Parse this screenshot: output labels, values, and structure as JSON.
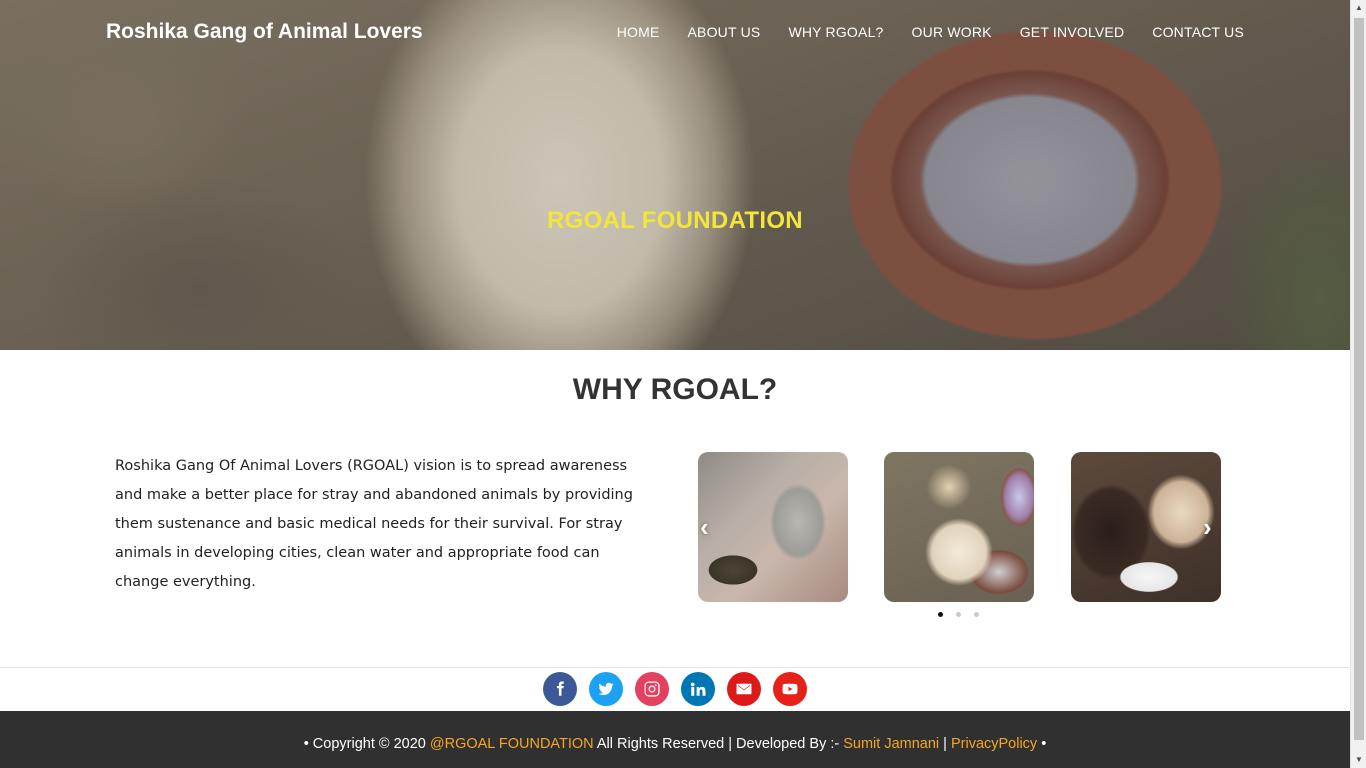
{
  "brand": "Roshika Gang of Animal Lovers",
  "nav": [
    {
      "label": "HOME"
    },
    {
      "label": "ABOUT US"
    },
    {
      "label": "WHY RGOAL?"
    },
    {
      "label": "OUR WORK"
    },
    {
      "label": "GET INVOLVED"
    },
    {
      "label": "CONTACT US"
    }
  ],
  "hero": {
    "title": "RGOAL FOUNDATION"
  },
  "why": {
    "heading": "WHY RGOAL?",
    "text": "Roshika Gang Of Animal Lovers (RGOAL) vision is to spread awareness and make a better place for stray and abandoned animals by providing them sustenance and basic medical needs for their survival. For stray animals in developing cities, clean water and appropriate food can change everything."
  },
  "carousel": {
    "prev_icon": "chevron-left-icon",
    "next_icon": "chevron-right-icon",
    "active_dot": 1,
    "dot_count": 3
  },
  "social": [
    {
      "name": "facebook",
      "color": "#3b5998"
    },
    {
      "name": "twitter",
      "color": "#1da1f2"
    },
    {
      "name": "instagram",
      "color": "#e4405f"
    },
    {
      "name": "linkedin",
      "color": "#0077b5"
    },
    {
      "name": "email",
      "color": "#dd1a1a"
    },
    {
      "name": "youtube",
      "color": "#e62117"
    }
  ],
  "footer": {
    "prefix": "• Copyright © 2020 ",
    "org_link": "@RGOAL FOUNDATION",
    "rights": " All Rights Reserved | Developed By :- ",
    "dev_link": "Sumit Jamnani",
    "sep": " | ",
    "privacy_link": "PrivacyPolicy",
    "suffix": " •"
  },
  "colors": {
    "hero_title": "#f2e53b",
    "footer_bg": "#303030",
    "footer_link": "#f5a623"
  }
}
